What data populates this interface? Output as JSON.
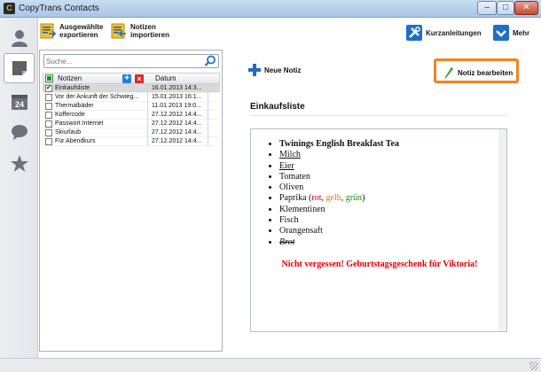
{
  "window": {
    "title": "CopyTrans Contacts",
    "app_icon_glyph": "C",
    "minimize_glyph": "–",
    "maximize_glyph": "□",
    "close_glyph": "✕"
  },
  "toolbar": {
    "export_line1": "Ausgewählte",
    "export_line2": "exportieren",
    "import_line1": "Notizen",
    "import_line2": "importieren",
    "guides_label": "Kurzanleitungen",
    "more_label": "Mehr"
  },
  "list": {
    "search_placeholder": "Suche...",
    "col_notes": "Notizen",
    "col_date": "Datum",
    "rows": [
      {
        "name": "Einkaufsliste",
        "date": "16.01.2013 14:3...",
        "checked": true,
        "selected": true
      },
      {
        "name": "Vor der Ankunft der Schwieg...",
        "date": "15.01.2013 16:1...",
        "checked": false,
        "selected": false
      },
      {
        "name": "Thermalbäder",
        "date": "11.01.2013 19:0...",
        "checked": false,
        "selected": false
      },
      {
        "name": "Koffercode",
        "date": "27.12.2012 14:4...",
        "checked": false,
        "selected": false
      },
      {
        "name": "Passwort Internet",
        "date": "27.12.2012 14:4...",
        "checked": false,
        "selected": false
      },
      {
        "name": "Skiurlaub",
        "date": "27.12.2012 14:4...",
        "checked": false,
        "selected": false
      },
      {
        "name": "Für Abendkurs",
        "date": "27.12.2012 14:4...",
        "checked": false,
        "selected": false
      }
    ]
  },
  "actions": {
    "new_note": "Neue Notiz",
    "edit_note": "Notiz bearbeiten"
  },
  "note": {
    "title": "Einkaufsliste",
    "items": {
      "i0": "Twinings English Breakfast Tea",
      "i1": "Milch",
      "i2": "Eier",
      "i3": "Tomaten",
      "i4": "Oliven",
      "i5_pre": "Paprika (",
      "i5_red": "rot",
      "i5_sep1": ", ",
      "i5_orange": "gelb",
      "i5_sep2": ", ",
      "i5_green": "grün",
      "i5_post": ")",
      "i6": "Klementinen",
      "i7": "Fisch",
      "i8": "Orangensaft",
      "i9": "Brot"
    },
    "reminder": "Nicht vergessen! Geburtstagsgeschenk für Viktoria!"
  },
  "colors": {
    "highlight_orange": "#f58220",
    "reminder_red": "#e00000",
    "accent_blue": "#1d6fc7"
  },
  "icons": {
    "rail": [
      "contacts-icon",
      "notes-icon",
      "calendar-icon",
      "messages-icon",
      "favorites-icon"
    ],
    "calendar_day": "24"
  }
}
